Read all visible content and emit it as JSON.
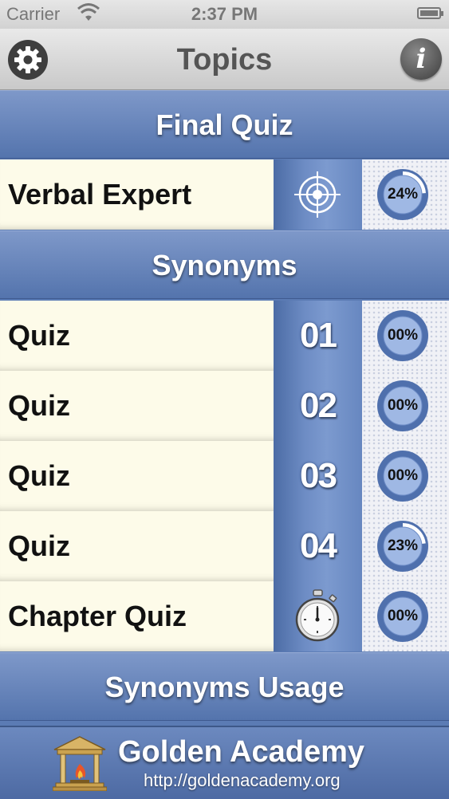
{
  "status_bar": {
    "carrier": "Carrier",
    "time": "2:37 PM"
  },
  "navbar": {
    "title": "Topics",
    "settings_icon": "gear-icon",
    "info_icon": "info-icon",
    "info_glyph": "i"
  },
  "sections": [
    {
      "title": "Final Quiz",
      "rows": [
        {
          "label": "Verbal Expert",
          "badge_icon": "target-icon",
          "progress": "24%",
          "progress_value": 0.24
        }
      ]
    },
    {
      "title": "Synonyms",
      "rows": [
        {
          "label": "Quiz",
          "number": "01",
          "progress": "00%",
          "progress_value": 0
        },
        {
          "label": "Quiz",
          "number": "02",
          "progress": "00%",
          "progress_value": 0
        },
        {
          "label": "Quiz",
          "number": "03",
          "progress": "00%",
          "progress_value": 0
        },
        {
          "label": "Quiz",
          "number": "04",
          "progress": "23%",
          "progress_value": 0.23
        },
        {
          "label": "Chapter Quiz",
          "badge_icon": "stopwatch-icon",
          "progress": "00%",
          "progress_value": 0
        }
      ]
    },
    {
      "title": "Synonyms Usage",
      "rows": []
    }
  ],
  "footer": {
    "brand": "Golden Academy",
    "url": "http://goldenacademy.org",
    "logo_icon": "academy-logo-icon"
  }
}
